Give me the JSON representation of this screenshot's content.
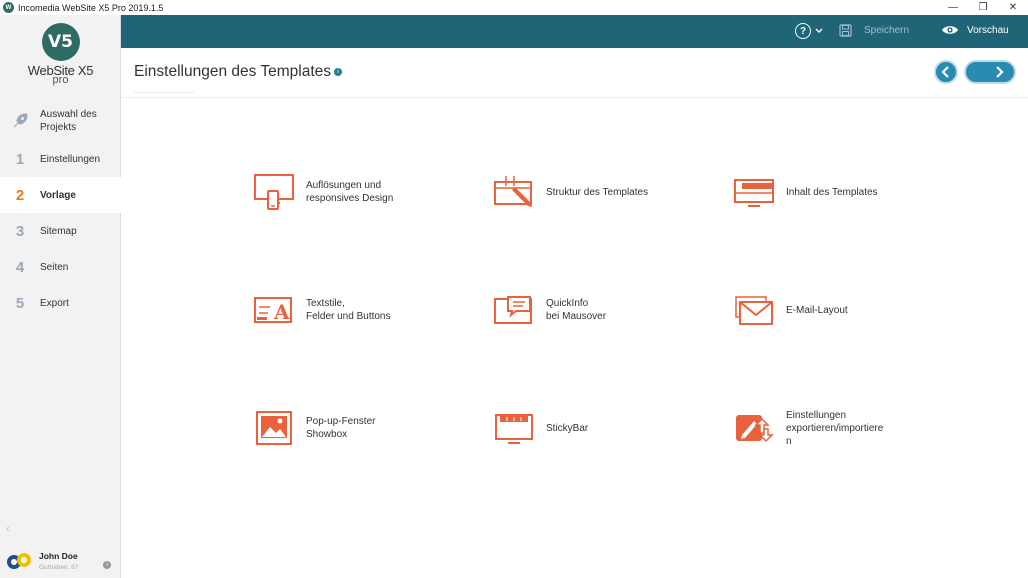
{
  "window": {
    "title": "Incomedia WebSite X5 Pro 2019.1.5",
    "controls": [
      "—",
      "❐",
      "✕"
    ]
  },
  "logo": {
    "mark": "V5",
    "name": "WebSite X5",
    "edition": "pro"
  },
  "sidebar": {
    "items": [
      {
        "num": "",
        "label_line1": "Auswahl des",
        "label_line2": "Projekts"
      },
      {
        "num": "1",
        "label": "Einstellungen"
      },
      {
        "num": "2",
        "label": "Vorlage"
      },
      {
        "num": "3",
        "label": "Sitemap"
      },
      {
        "num": "4",
        "label": "Seiten"
      },
      {
        "num": "5",
        "label": "Export"
      }
    ],
    "collapse": "‹"
  },
  "user": {
    "name": "John Doe",
    "credit": "Guthaben: 87"
  },
  "toolbar": {
    "help": "?",
    "save_label": "Speichern",
    "preview_label": "Vorschau"
  },
  "header": {
    "title": "Einstellungen des Templates",
    "info": "i"
  },
  "tiles": [
    {
      "line1": "Auflösungen und",
      "line2": "responsives Design"
    },
    {
      "line1": "Struktur des Templates",
      "line2": ""
    },
    {
      "line1": "Inhalt des Templates",
      "line2": ""
    },
    {
      "line1": "Textstile,",
      "line2": "Felder und Buttons"
    },
    {
      "line1": "QuickInfo",
      "line2": "bei Mausover"
    },
    {
      "line1": "E-Mail-Layout",
      "line2": ""
    },
    {
      "line1": "Pop-up-Fenster",
      "line2": "Showbox"
    },
    {
      "line1": "StickyBar",
      "line2": ""
    },
    {
      "line1": "Einstellungen",
      "line2": "exportieren/importiere",
      "line3": "n"
    }
  ],
  "colors": {
    "accent_orange": "#e8623d",
    "topbar": "#1f6577",
    "nav_active": "#e87c1e",
    "button_blue": "#2a8ab0"
  }
}
